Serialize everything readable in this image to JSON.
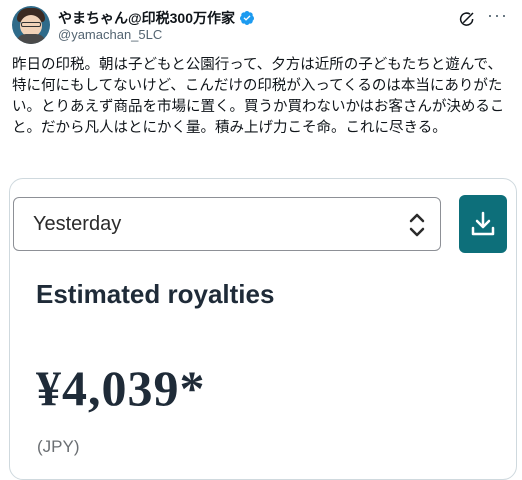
{
  "tweet": {
    "display_name": "やまちゃん@印税300万作家",
    "handle": "@yamachan_5LC",
    "text": "昨日の印税。朝は子どもと公園行って、夕方は近所の子どもたちと遊んで、特に何にもしてないけど、こんだけの印税が入ってくるのは本当にありがたい。とりあえず商品を市場に置く。買うか買わないかはお客さんが決めること。だから凡人はとにかく量。積み上げ力こそ命。これに尽きる。",
    "verified_color": "#1d9bf0",
    "icons": [
      "grok-icon",
      "more-icon"
    ]
  },
  "card": {
    "date_select": {
      "selected": "Yesterday"
    },
    "download_label": "download-icon",
    "title": "Estimated royalties",
    "amount": "¥4,039*",
    "currency": "(JPY)",
    "accent": "#0d6f7a"
  }
}
